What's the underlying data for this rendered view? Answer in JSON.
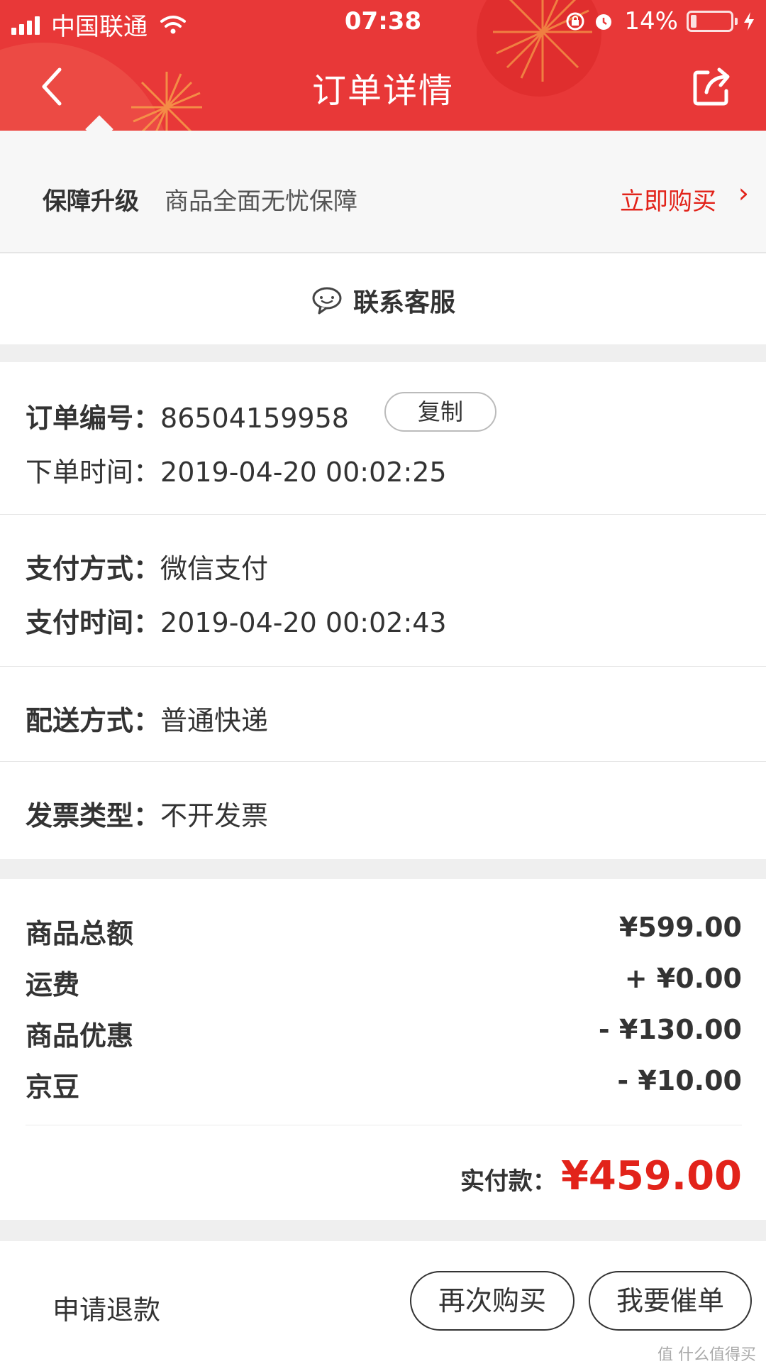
{
  "status_bar": {
    "carrier": "中国联通",
    "time": "07:38",
    "battery": "14%"
  },
  "nav": {
    "title": "订单详情",
    "back_icon": "chevron-left-icon",
    "share_icon": "share-icon"
  },
  "protection": {
    "title": "保障升级",
    "description": "商品全面无忧保障",
    "action": "立即购买",
    "arrow": "›"
  },
  "contact": {
    "label": "联系客服",
    "icon": "chat-bubble-icon"
  },
  "order": {
    "number_label": "订单编号：",
    "number": "86504159958",
    "copy_label": "复制",
    "time_label": "下单时间：",
    "time": "2019-04-20 00:02:25",
    "pay_method_label": "支付方式：",
    "pay_method": "微信支付",
    "pay_time_label": "支付时间：",
    "pay_time": "2019-04-20 00:02:43",
    "delivery_label": "配送方式：",
    "delivery": "普通快递",
    "invoice_label": "发票类型：",
    "invoice": "不开发票"
  },
  "price": {
    "rows": [
      {
        "label": "商品总额",
        "value": "¥599.00"
      },
      {
        "label": "运费",
        "value": "+ ¥0.00"
      },
      {
        "label": "商品优惠",
        "value": "- ¥130.00"
      },
      {
        "label": "京豆",
        "value": "- ¥10.00"
      }
    ],
    "total_label": "实付款：",
    "total_value": "¥459.00"
  },
  "actions": {
    "refund": "申请退款",
    "rebuy": "再次购买",
    "urge": "我要催单"
  },
  "watermark": "值 什么值得买",
  "colors": {
    "header_red": "#e83838",
    "accent_red": "#e2231a"
  }
}
